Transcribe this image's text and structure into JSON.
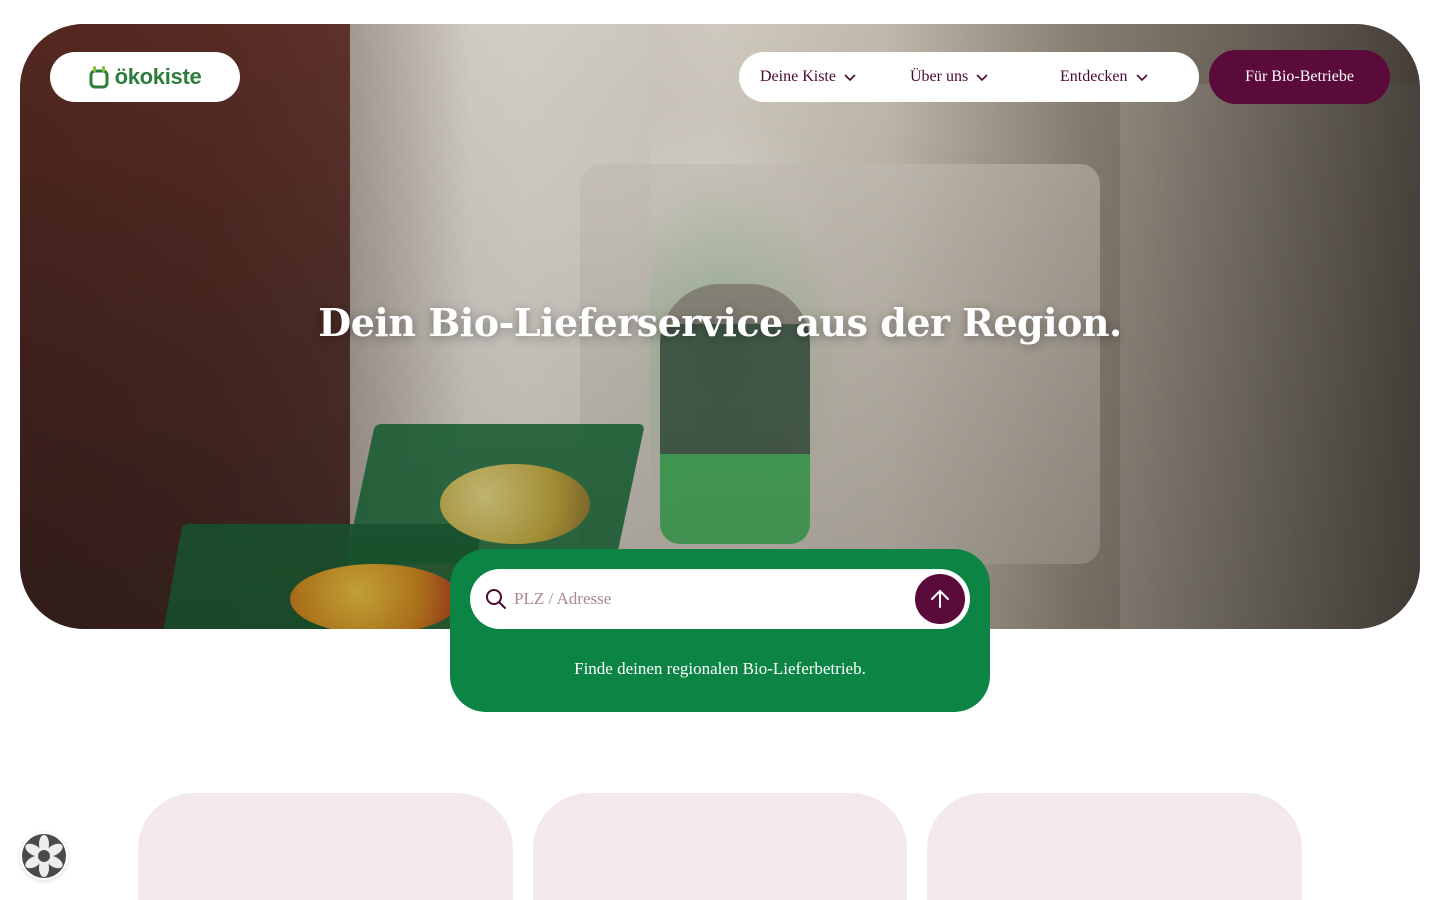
{
  "brand": {
    "name": "ökokiste",
    "color": "#2e7d3c"
  },
  "nav": {
    "items": [
      {
        "label": "Deine Kiste"
      },
      {
        "label": "Über uns"
      },
      {
        "label": "Entdecken"
      }
    ],
    "cta_label": "Für Bio-Betriebe"
  },
  "hero": {
    "title": "Dein Bio-Lieferservice aus der Region."
  },
  "search": {
    "placeholder": "PLZ / Adresse",
    "value": "",
    "hint": "Finde deinen regionalen Bio-Lieferbetrieb."
  },
  "colors": {
    "primary": "#5a0b3a",
    "green": "#0c8443",
    "card_bg": "#f3e8ee"
  },
  "icons": {
    "search": "search-icon",
    "submit": "arrow-up-icon",
    "dropdown": "chevron-down-icon",
    "cookie": "cookie-settings-icon"
  }
}
